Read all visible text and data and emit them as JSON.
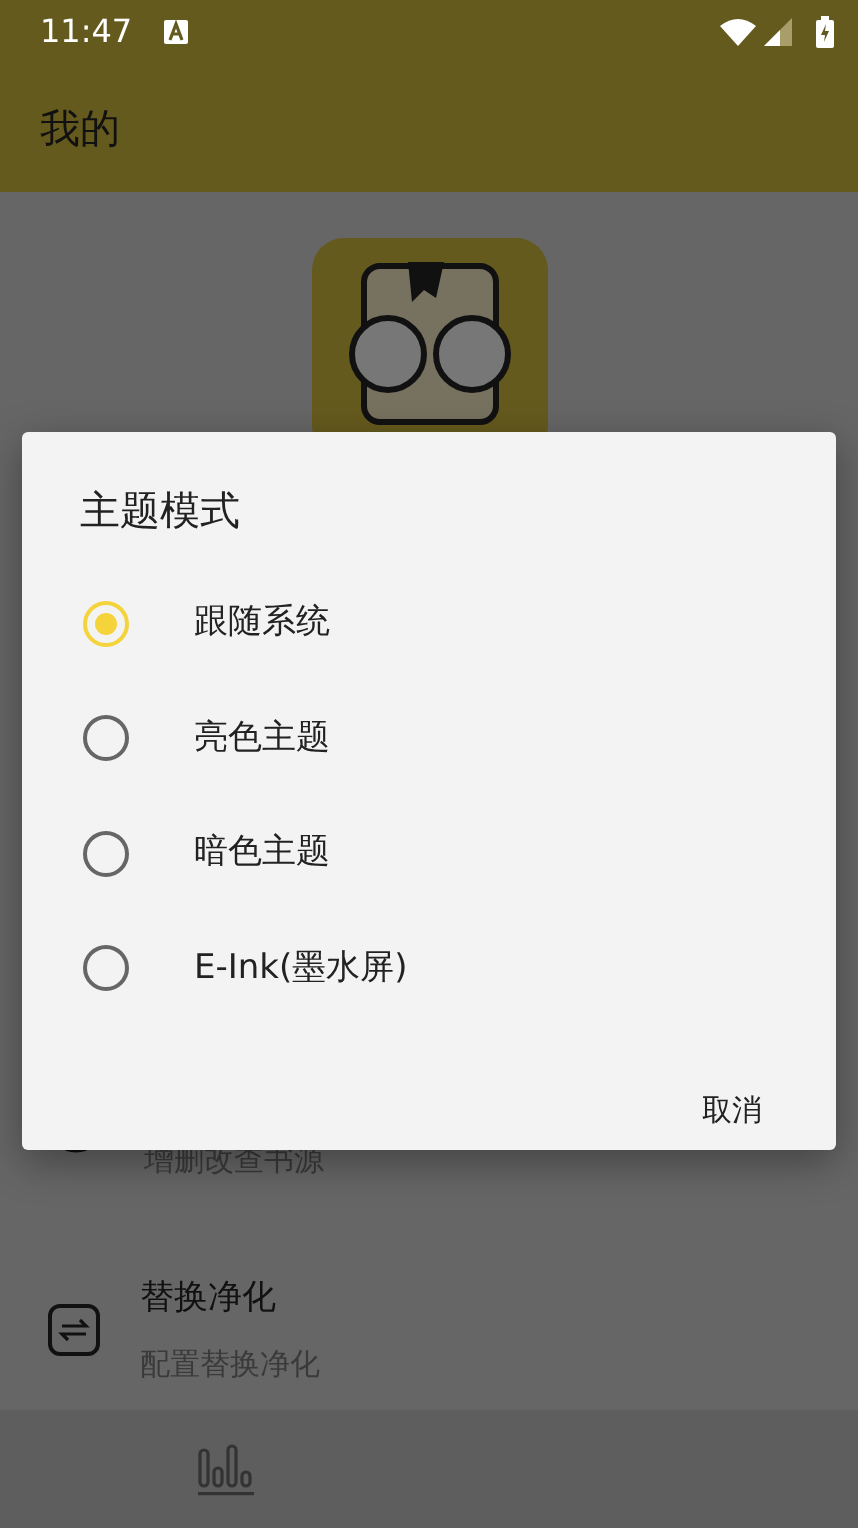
{
  "status_bar": {
    "time": "11:47"
  },
  "toolbar": {
    "title": "我的"
  },
  "list_items": [
    {
      "kind": "book",
      "subtitle": "增删改查书源"
    },
    {
      "kind": "replace",
      "title": "替换净化",
      "subtitle": "配置替换净化"
    }
  ],
  "dialog": {
    "title": "主题模式",
    "options": [
      {
        "label": "跟随系统",
        "selected": true
      },
      {
        "label": "亮色主题",
        "selected": false
      },
      {
        "label": "暗色主题",
        "selected": false
      },
      {
        "label": "E-Ink(墨水屏)",
        "selected": false
      }
    ],
    "buttons": [
      "取消"
    ]
  }
}
